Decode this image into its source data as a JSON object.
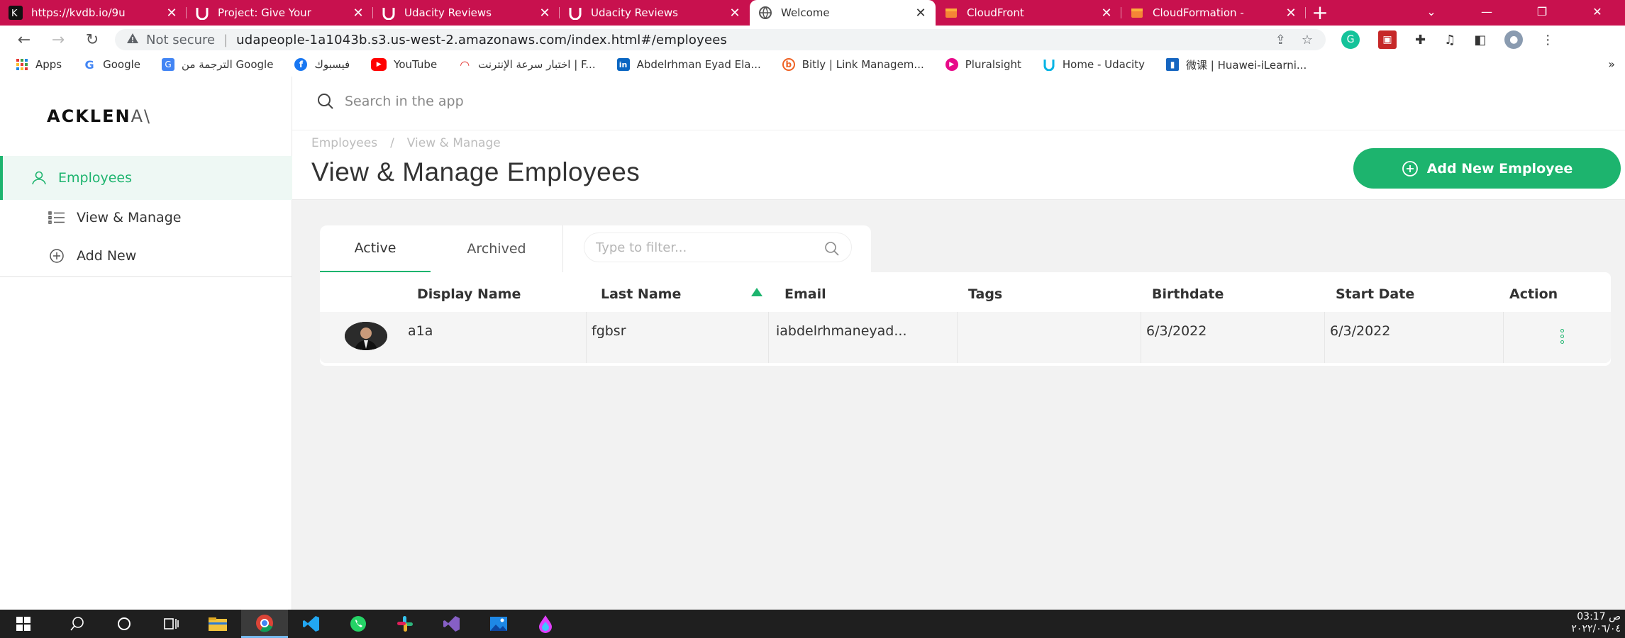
{
  "browser": {
    "tabs": [
      {
        "title": "https://kvdb.io/9u",
        "icon": "kvdb-icon",
        "active": false
      },
      {
        "title": "Project: Give Your",
        "icon": "udacity-icon",
        "active": false
      },
      {
        "title": "Udacity Reviews",
        "icon": "udacity-icon",
        "active": false
      },
      {
        "title": "Udacity Reviews",
        "icon": "udacity-icon",
        "active": false
      },
      {
        "title": "Welcome",
        "icon": "globe-icon",
        "active": true
      },
      {
        "title": "CloudFront",
        "icon": "aws-cube-icon",
        "active": false
      },
      {
        "title": "CloudFormation -",
        "icon": "aws-cube-icon",
        "active": false
      }
    ],
    "new_tab": "+",
    "close_glyph": "✕",
    "not_secure": "Not secure",
    "url": "udapeople-1a1043b.s3.us-west-2.amazonaws.com/index.html#/employees",
    "bookmarks": [
      {
        "label": "Apps",
        "icon": "apps-grid-icon"
      },
      {
        "label": "Google",
        "icon": "google-icon"
      },
      {
        "label": "الترجمة من Google",
        "icon": "google-translate-icon"
      },
      {
        "label": "فيسبوك",
        "icon": "facebook-icon"
      },
      {
        "label": "YouTube",
        "icon": "youtube-icon"
      },
      {
        "label": "اختبار سرعة الإنترنت | F...",
        "icon": "speedtest-icon"
      },
      {
        "label": "Abdelrhman Eyad Ela...",
        "icon": "linkedin-icon"
      },
      {
        "label": "Bitly | Link Managem...",
        "icon": "bitly-icon"
      },
      {
        "label": "Pluralsight",
        "icon": "pluralsight-icon"
      },
      {
        "label": "Home - Udacity",
        "icon": "udacity-icon"
      },
      {
        "label": "微课 | Huawei-iLearni...",
        "icon": "huawei-icon"
      }
    ],
    "bookmarks_more": "»"
  },
  "app": {
    "logo_bold": "ACKLEN",
    "logo_thin": "A\\",
    "search_placeholder": "Search in the app",
    "nav": {
      "employees": "Employees",
      "view_manage": "View & Manage",
      "add_new": "Add New"
    },
    "breadcrumb": {
      "first": "Employees",
      "sep": "/",
      "second": "View & Manage"
    },
    "page_title": "View & Manage Employees",
    "add_button": "Add New Employee",
    "tabs": {
      "active": "Active",
      "archived": "Archived"
    },
    "filter_placeholder": "Type to filter...",
    "columns": [
      "Display Name",
      "Last Name",
      "Email",
      "Tags",
      "Birthdate",
      "Start Date",
      "Action"
    ],
    "rows": [
      {
        "display_name": "a1a",
        "last_name": "fgbsr",
        "email": "iabdelrhmaneyad...",
        "tags": "",
        "birthdate": "6/3/2022",
        "start_date": "6/3/2022"
      }
    ]
  },
  "taskbar": {
    "time": "03:17 ص",
    "date": "٢٠٢٢/٠٦/٠٤"
  },
  "colors": {
    "brand": "#1db46e",
    "tabstrip": "#c8114e"
  }
}
